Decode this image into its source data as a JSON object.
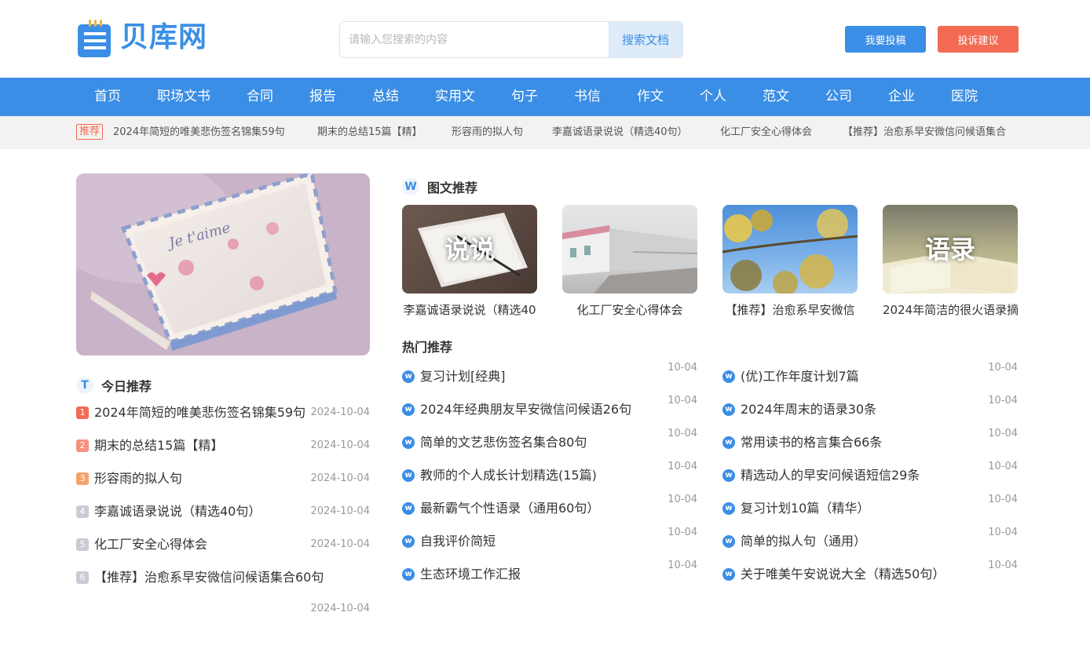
{
  "brand": {
    "name": "贝库网",
    "color": "#3a8ee6"
  },
  "search": {
    "placeholder": "请输入您搜索的内容",
    "button": "搜索文档"
  },
  "header_buttons": {
    "submit": "我要投稿",
    "complain": "投诉建议"
  },
  "nav": [
    "首页",
    "职场文书",
    "合同",
    "报告",
    "总结",
    "实用文",
    "句子",
    "书信",
    "作文",
    "个人",
    "范文",
    "公司",
    "企业",
    "医院"
  ],
  "ticker": {
    "badge": "推荐",
    "items": [
      "2024年简短的唯美悲伤签名锦集59句",
      "期末的总结15篇【精】",
      "形容雨的拟人句",
      "李嘉诚语录说说（精选40句）",
      "化工厂安全心得体会",
      "【推荐】治愈系早安微信问候语集合"
    ]
  },
  "today": {
    "icon": "T",
    "title": "今日推荐",
    "items": [
      {
        "rank": "1",
        "title": "2024年简短的唯美悲伤签名锦集59句",
        "date": "2024-10-04",
        "color": "#f26b52"
      },
      {
        "rank": "2",
        "title": "期末的总结15篇【精】",
        "date": "2024-10-04",
        "color": "#f5917c"
      },
      {
        "rank": "3",
        "title": "形容雨的拟人句",
        "date": "2024-10-04",
        "color": "#f3a46a"
      },
      {
        "rank": "4",
        "title": "李嘉诚语录说说（精选40句）",
        "date": "2024-10-04",
        "color": "#c9ccd4"
      },
      {
        "rank": "5",
        "title": "化工厂安全心得体会",
        "date": "2024-10-04",
        "color": "#c9ccd4"
      },
      {
        "rank": "6",
        "title": "【推荐】治愈系早安微信问候语集合60句",
        "date": "2024-10-04",
        "color": "#c9ccd4"
      }
    ]
  },
  "pictures": {
    "icon": "W",
    "title": "图文推荐",
    "items": [
      {
        "caption": "李嘉诚语录说说（精选40",
        "overlay": "说说"
      },
      {
        "caption": "化工厂安全心得体会",
        "overlay": ""
      },
      {
        "caption": "【推荐】治愈系早安微信",
        "overlay": ""
      },
      {
        "caption": "2024年简洁的很火语录摘",
        "overlay": "语录"
      }
    ]
  },
  "hot": {
    "title": "热门推荐",
    "icon": "w",
    "left": [
      {
        "title": "复习计划[经典]",
        "date": "10-04"
      },
      {
        "title": "2024年经典朋友早安微信问候语26句",
        "date": "10-04"
      },
      {
        "title": "简单的文艺悲伤签名集合80句",
        "date": "10-04"
      },
      {
        "title": "教师的个人成长计划精选(15篇)",
        "date": "10-04"
      },
      {
        "title": "最新霸气个性语录（通用60句）",
        "date": "10-04"
      },
      {
        "title": "自我评价简短",
        "date": "10-04"
      },
      {
        "title": "生态环境工作汇报",
        "date": "10-04"
      }
    ],
    "right": [
      {
        "title": "(优)工作年度计划7篇",
        "date": "10-04"
      },
      {
        "title": "2024年周末的语录30条",
        "date": "10-04"
      },
      {
        "title": "常用读书的格言集合66条",
        "date": "10-04"
      },
      {
        "title": "精选动人的早安问候语短信29条",
        "date": "10-04"
      },
      {
        "title": "复习计划10篇（精华）",
        "date": "10-04"
      },
      {
        "title": "简单的拟人句（通用）",
        "date": "10-04"
      },
      {
        "title": "关于唯美午安说说大全（精选50句）",
        "date": "10-04"
      }
    ]
  }
}
